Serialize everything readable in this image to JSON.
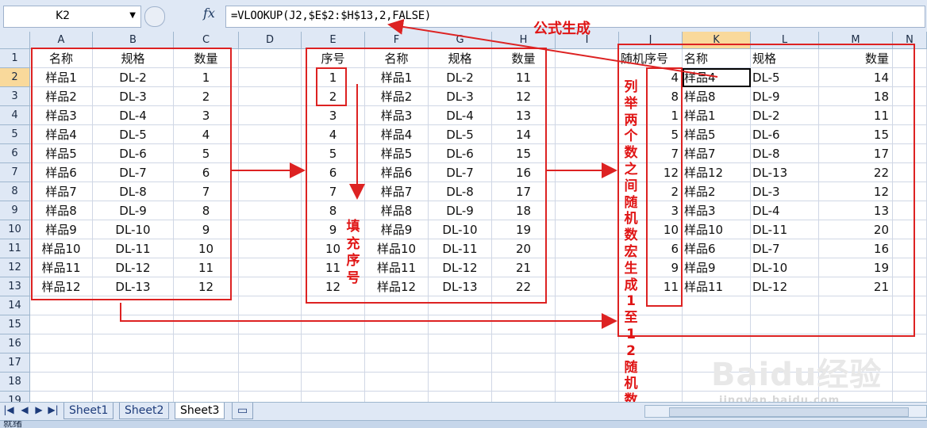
{
  "formula_bar": {
    "name_box": "K2",
    "fx_label": "fx",
    "formula": "=VLOOKUP(J2,$E$2:$H$13,2,FALSE)"
  },
  "columns": [
    "A",
    "B",
    "C",
    "D",
    "E",
    "F",
    "G",
    "H",
    "I",
    "J",
    "K",
    "L",
    "M",
    "N"
  ],
  "highlighted_column": "K",
  "rows": [
    "1",
    "2",
    "3",
    "4",
    "5",
    "6",
    "7",
    "8",
    "9",
    "10",
    "11",
    "12",
    "13",
    "14",
    "15",
    "16",
    "17",
    "18",
    "19"
  ],
  "highlighted_row": "2",
  "cells": {
    "A": [
      "名称",
      "样品1",
      "样品2",
      "样品3",
      "样品4",
      "样品5",
      "样品6",
      "样品7",
      "样品8",
      "样品9",
      "样品10",
      "样品11",
      "样品12"
    ],
    "B": [
      "规格",
      "DL-2",
      "DL-3",
      "DL-4",
      "DL-5",
      "DL-6",
      "DL-7",
      "DL-8",
      "DL-9",
      "DL-10",
      "DL-11",
      "DL-12",
      "DL-13"
    ],
    "C": [
      "数量",
      "1",
      "2",
      "3",
      "4",
      "5",
      "6",
      "7",
      "8",
      "9",
      "10",
      "11",
      "12"
    ],
    "E": [
      "序号",
      "1",
      "2",
      "3",
      "4",
      "5",
      "6",
      "7",
      "8",
      "9",
      "10",
      "11",
      "12"
    ],
    "F": [
      "名称",
      "样品1",
      "样品2",
      "样品3",
      "样品4",
      "样品5",
      "样品6",
      "样品7",
      "样品8",
      "样品9",
      "样品10",
      "样品11",
      "样品12"
    ],
    "G": [
      "规格",
      "DL-2",
      "DL-3",
      "DL-4",
      "DL-5",
      "DL-6",
      "DL-7",
      "DL-8",
      "DL-9",
      "DL-10",
      "DL-11",
      "DL-12",
      "DL-13"
    ],
    "H": [
      "数量",
      "11",
      "12",
      "13",
      "14",
      "15",
      "16",
      "17",
      "18",
      "19",
      "20",
      "21",
      "22"
    ],
    "J": [
      "随机序号",
      "4",
      "8",
      "1",
      "5",
      "7",
      "12",
      "2",
      "3",
      "10",
      "6",
      "9",
      "11"
    ],
    "K": [
      "名称",
      "样品4",
      "样品8",
      "样品1",
      "样品5",
      "样品7",
      "样品12",
      "样品2",
      "样品3",
      "样品10",
      "样品6",
      "样品9",
      "样品11"
    ],
    "L": [
      "规格",
      "DL-5",
      "DL-9",
      "DL-2",
      "DL-6",
      "DL-8",
      "DL-13",
      "DL-3",
      "DL-4",
      "DL-11",
      "DL-7",
      "DL-10",
      "DL-12"
    ],
    "M": [
      "数量",
      "14",
      "18",
      "11",
      "15",
      "17",
      "22",
      "12",
      "13",
      "20",
      "16",
      "19",
      "21"
    ]
  },
  "annotations": {
    "formula_label": "公式生成",
    "fill_label": "填充序号",
    "random_label": "列举两个数之间随机数宏生成1至12随机数"
  },
  "sheet_tabs": [
    "Sheet1",
    "Sheet2",
    "Sheet3"
  ],
  "active_sheet": "Sheet3",
  "status": "就绪",
  "watermark": {
    "brand": "Baidu经验",
    "url": "jingyan.baidu.com"
  },
  "colors": {
    "annotation": "#e01515",
    "header_bg": "#dfe8f5",
    "header_highlight": "#f9d99b"
  }
}
